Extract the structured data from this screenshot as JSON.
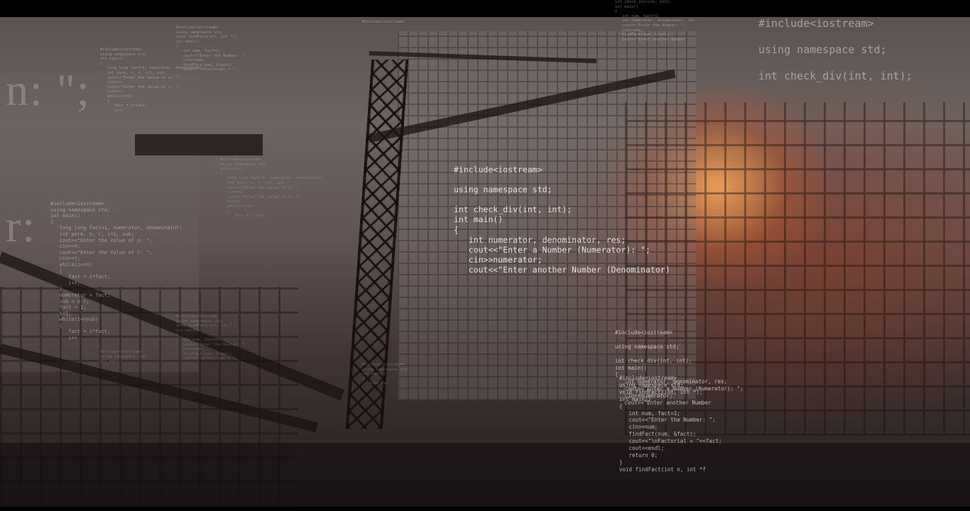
{
  "ghost_text": {
    "line1": "n: \";",
    "line2": "r:"
  },
  "code_blocks": {
    "center": "#include<iostream>\n\nusing namespace std;\n\nint check_div(int, int);\nint main()\n{\n   int numerator, denominator, res;\n   cout<<\"Enter a Number (Numerator): \";\n   cin>>numerator;\n   cout<<\"Enter another Number (Denominator)",
    "top_right": "#include<iostream>\nusing namespace std;\nint check_div(int, int);",
    "left": "#include<iostream>\nusing namespace std;\nint main()\n{\n   long long fact=1, numerator, denominator;\n   int perm, n, r, i=1, sub;\n   cout<<\"Enter the Value of n: \";\n   cin>>n;\n   cout<<\"Enter the Value of r: \";\n   cin>>r;\n   while(i<=n)\n   {\n      fact = i*fact;\n      i++;\n   }\n   numerator = fact;\n   sub = n-r;\n   fact = 1;\n   i=1;\n   while(i<=sub)\n   {\n      fact = i*fact;\n      i++",
    "top_left": "#include<iostream>\nusing namespace std;\nint main()\n{\n   long long fact=1, numerator, denominator;\n   int perm, n, r, i=1, sub;\n   cout<<\"Enter the Value of n: \";\n   cin>>n;\n   cout<<\"Enter the Value of r: \";\n   cin>>r;\n   while(i<=n)\n   {\n      fact = i*fact;\n      i++;",
    "top_mid": "#include<iostream>\nusing namespace std;\nvoid findFact(int, int *);\nint main()\n{\n   int num, fact=1;\n   cout<<\"Enter the Number: \";\n   cin>>num;\n   findFact(num, &fact);\n   cout<<\"\\nFactorial = \";",
    "mid_small": "#include<iostream>\nusing namespace std;\nint main()\n{\n   long long fact=1, numerator, denominator;\n   int perm, n, r, i=1, sub;\n   cout<<\"Enter the Value of n: \";\n   cin>>n;\n   cout<<\"Enter the Value of r: \";\n   cin>>r;\n   while(i<=n)\n   {\n      fact = i*fact;",
    "top_strip": "int check_div(int, int);\nint main()\n{\n   int num, fact=1;\n   int numerator, denominator, res;\n   cout<<\"Enter the Number: \";\n   cin>>num;\n   findFact(num, &fact);\n   cout<<\"Enter another Number",
    "bottom_right": "#include<iostream>\n\nusing namespace std;\n\nint check_div(int, int);\nint main()\n{\n   int numerator, denominator, res;\n   cout<<\"Enter a Number (Numerator): \";\n   cin>>numerator;\n   cout<<\"Enter another Number",
    "bottom_right_2": "#include<iostream>\nusing namespace std;\nvoid findFact(int, int *);\nint main()\n{\n   int num, fact=1;\n   cout<<\"Enter the Number: \";\n   cin>>num;\n   findFact(num, &fact);\n   cout<<\"\\nFactorial = \"<<fact;\n   cout<<endl;\n   return 0;\n}\nvoid findFact(int n, int *f",
    "bottom_mid_left": "#include<iostream>\nusing namespace std;\nvoid findFact(int, int *);\nint main()\n{\n   int num, fact=1;\n   cout<<\"Enter the Number: \";\n   cin>>num;\n   findFact(num, &fact);\n   cout<<\"\\nFactorial = \";",
    "bottom_center": "#include<iostream>\nusing namespace std;\nint main()\n{\n   long fac",
    "top_center_small": "#include<iostream>",
    "far_left_small": "#include<iostream>\nusing namespace std;\nint main"
  }
}
